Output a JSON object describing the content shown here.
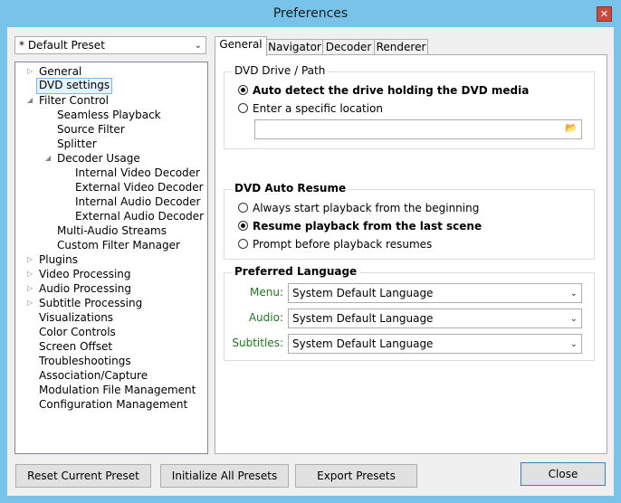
{
  "window": {
    "title": "Preferences",
    "close_glyph": "✕"
  },
  "preset": {
    "selected": "* Default Preset"
  },
  "tree": [
    {
      "label": "General",
      "arrow": "▷"
    },
    {
      "label": "DVD settings",
      "selected": true
    },
    {
      "label": "Filter Control",
      "arrow": "◢"
    },
    {
      "label": "Seamless Playback"
    },
    {
      "label": "Source Filter"
    },
    {
      "label": "Splitter"
    },
    {
      "label": "Decoder Usage",
      "arrow": "◢"
    },
    {
      "label": "Internal Video Decoder"
    },
    {
      "label": "External Video Decoder"
    },
    {
      "label": "Internal Audio Decoder"
    },
    {
      "label": "External Audio Decoder"
    },
    {
      "label": "Multi-Audio Streams"
    },
    {
      "label": "Custom Filter Manager"
    },
    {
      "label": "Plugins",
      "arrow": "▷"
    },
    {
      "label": "Video Processing",
      "arrow": "▷"
    },
    {
      "label": "Audio Processing",
      "arrow": "▷"
    },
    {
      "label": "Subtitle Processing",
      "arrow": "▷"
    },
    {
      "label": "Visualizations"
    },
    {
      "label": "Color Controls"
    },
    {
      "label": "Screen Offset"
    },
    {
      "label": "Troubleshootings"
    },
    {
      "label": "Association/Capture"
    },
    {
      "label": "Modulation File Management"
    },
    {
      "label": "Configuration Management"
    }
  ],
  "tabs": [
    "General",
    "Navigator",
    "Decoder",
    "Renderer"
  ],
  "dvd_drive": {
    "title": "DVD Drive / Path",
    "auto_detect": "Auto detect the drive holding the DVD media",
    "specific": "Enter a specific location",
    "path_value": ""
  },
  "auto_resume": {
    "title": "DVD Auto Resume",
    "always": "Always start playback from the beginning",
    "resume": "Resume playback from the last scene",
    "prompt": "Prompt before playback resumes"
  },
  "language": {
    "title": "Preferred Language",
    "menu_label": "Menu:",
    "audio_label": "Audio:",
    "subtitles_label": "Subtitles:",
    "menu_value": "System Default Language",
    "audio_value": "System Default Language",
    "subtitles_value": "System Default Language"
  },
  "buttons": {
    "reset": "Reset Current Preset",
    "initialize": "Initialize All Presets",
    "export": "Export Presets",
    "close": "Close"
  },
  "colors": {
    "accent": "#77c3e9",
    "label_green": "#1e7a1e",
    "close_red": "#c74a3e"
  }
}
